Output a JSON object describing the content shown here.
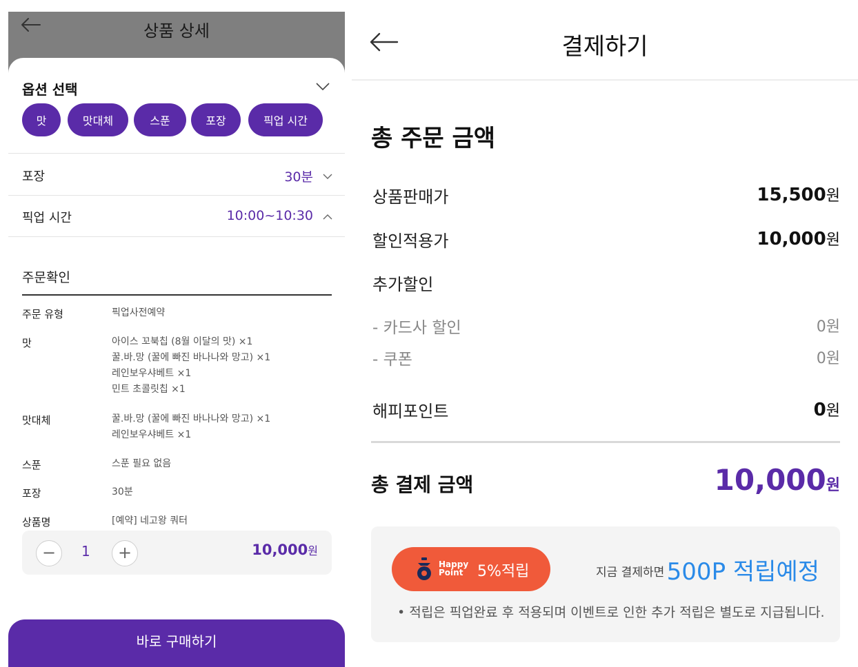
{
  "left": {
    "header_title": "상품 상세",
    "option_title": "옵션 선택",
    "chips": [
      "맛",
      "맛대체",
      "스푼",
      "포장",
      "픽업 시간"
    ],
    "rows": [
      {
        "label": "포장",
        "value": "30분"
      },
      {
        "label": "픽업 시간",
        "value": "10:00~10:30"
      }
    ],
    "confirm_title": "주문확인",
    "details": [
      {
        "label": "주문 유형",
        "lines": [
          "픽업사전예약"
        ]
      },
      {
        "label": "맛",
        "lines": [
          "아이스 꼬북칩 (8월 이달의 맛) ×1",
          "꿀.바.망 (꿀에 빠진 바나나와 망고) ×1",
          "레인보우샤베트 ×1",
          "민트 초콜릿칩 ×1"
        ]
      },
      {
        "label": "맛대체",
        "lines": [
          "꿀.바.망 (꿀에 빠진 바나나와 망고) ×1",
          "레인보우샤베트 ×1"
        ]
      },
      {
        "label": "스푼",
        "lines": [
          "스푼 필요 없음"
        ]
      },
      {
        "label": "포장",
        "lines": [
          "30분"
        ]
      },
      {
        "label": "상품명",
        "lines": [
          "[예약] 네고왕 쿼터"
        ]
      }
    ],
    "quantity": {
      "minus": "−",
      "value": "1",
      "plus": "+",
      "price": "10,000",
      "won": "원"
    },
    "buy_button": "바로 구매하기"
  },
  "right": {
    "title": "결제하기",
    "total_order_title": "총 주문 금액",
    "items": [
      {
        "label": "상품판매가",
        "value": "15,500",
        "won": "원"
      },
      {
        "label": "할인적용가",
        "value": "10,000",
        "won": "원"
      }
    ],
    "extra_discount_label": "추가할인",
    "sub_items": [
      {
        "label": "- 카드사 할인",
        "value": "0원"
      },
      {
        "label": "- 쿠폰",
        "value": "0원"
      }
    ],
    "happy_point": {
      "label": "해피포인트",
      "value": "0",
      "won": "원"
    },
    "total_pay": {
      "label": "총 결제 금액",
      "value": "10,000",
      "won": "원"
    },
    "point_card": {
      "logo_line1": "Happy",
      "logo_line2": "Point",
      "rate": "5%적립",
      "prefix": "지금 결제하면",
      "amount": "500P 적립예정",
      "note": "• 적립은 픽업완료 후 적용되며 이벤트로 인한 추가 적립은 별도로 지급됩니다."
    }
  },
  "colors": {
    "accent": "#5a2ba8",
    "point_blue": "#2a8ae8",
    "happy_point_orange": "#f05a3a"
  },
  "icons": [
    "back-arrow-icon",
    "chevron-down-icon",
    "chevron-up-icon",
    "minus-icon",
    "plus-icon",
    "happy-point-logo-icon"
  ]
}
